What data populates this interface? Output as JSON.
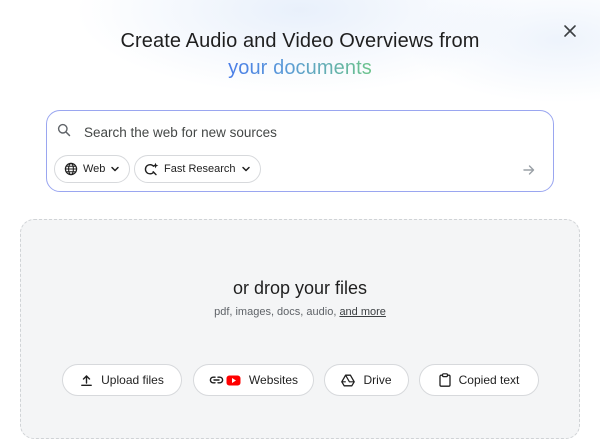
{
  "dialog": {
    "title_line1": "Create Audio and Video Overviews from",
    "title_accent": "your documents",
    "close_icon": "close-icon"
  },
  "search": {
    "placeholder": "Search the web for new sources",
    "value": "",
    "source_chip": {
      "label": "Web",
      "icon": "globe-icon"
    },
    "mode_chip": {
      "label": "Fast Research",
      "icon": "fast-research-icon"
    },
    "submit_icon": "arrow-right-icon",
    "border_color": "#9aa6f0"
  },
  "dropzone": {
    "title": "or drop your files",
    "subtitle": "pdf, images, docs, audio,",
    "more_link": "and more"
  },
  "sources": [
    {
      "label": "Upload files",
      "icon": "upload-icon"
    },
    {
      "label": "Websites",
      "icon": "link-youtube-icon"
    },
    {
      "label": "Drive",
      "icon": "drive-icon"
    },
    {
      "label": "Copied text",
      "icon": "clipboard-icon"
    }
  ],
  "colors": {
    "accent_start": "#4a7de8",
    "accent_end": "#6cc48a",
    "youtube_red": "#ff0000"
  }
}
